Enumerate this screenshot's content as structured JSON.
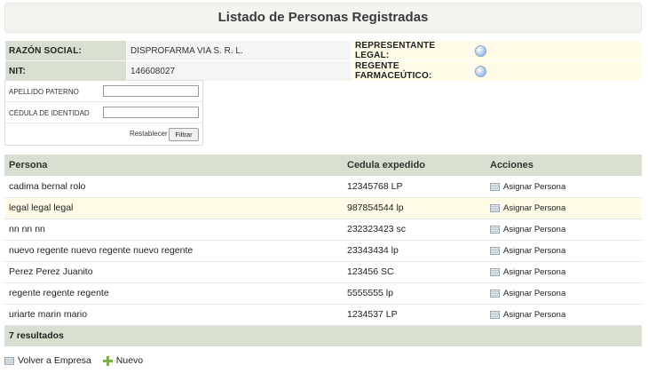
{
  "page": {
    "title": "Listado de Personas Registradas"
  },
  "company": {
    "razon_social_label": "RAZÓN SOCIAL:",
    "razon_social_value": "DISPROFARMA VIA S. R. L.",
    "nit_label": "NIT:",
    "nit_value": "146608027",
    "representante_label": "REPRESENTANTE LEGAL:",
    "regente_label": "REGENTE FARMACEÚTICO:"
  },
  "filter": {
    "apellido_label": "APELLIDO PATERNO",
    "apellido_value": "",
    "cedula_label": "CÉDULA DE IDENTIDAD",
    "cedula_value": "",
    "reset_label": "Restablecer",
    "filter_label": "Filtrar"
  },
  "table": {
    "headers": [
      "Persona",
      "Cedula expedido",
      "Acciones"
    ],
    "action_label": "Asignar Persona",
    "rows": [
      {
        "persona": "cadima bernal rolo",
        "cedula": "12345768 LP"
      },
      {
        "persona": "legal legal legal",
        "cedula": "987854544 lp"
      },
      {
        "persona": "nn nn nn",
        "cedula": "232323423 sc"
      },
      {
        "persona": "nuevo regente nuevo regente nuevo regente",
        "cedula": "23343434 lp"
      },
      {
        "persona": "Perez Perez Juanito",
        "cedula": "123456 SC"
      },
      {
        "persona": "regente regente regente",
        "cedula": "5555555 lp"
      },
      {
        "persona": "uriarte marin mario",
        "cedula": "1234537 LP"
      }
    ],
    "footer": "7 resultados"
  },
  "links": {
    "volver": "Volver a Empresa",
    "nuevo": "Nuevo"
  },
  "colors": {
    "header_bg": "#d7e0d0",
    "highlight_bg": "#fffbe6",
    "plus_icon": "#7fb04a"
  }
}
